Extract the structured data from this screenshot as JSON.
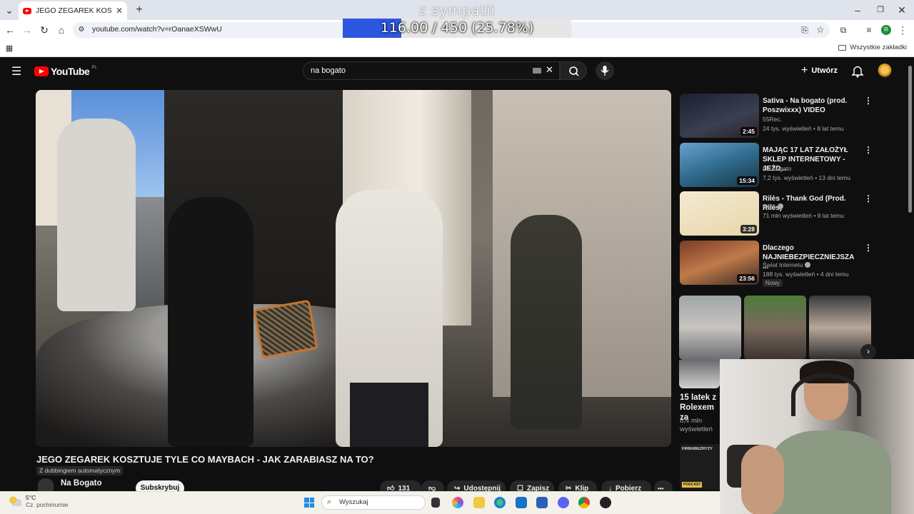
{
  "browser": {
    "tab_title": "JEGO ZEGAREK KOSZTUJE TYLE",
    "new_tab": "+",
    "url": "youtube.com/watch?v=rOanaeXSWwU",
    "bookmarks_all": "Wszystkie zakładki",
    "profile_initial": "R"
  },
  "overlay": {
    "title": "z sympatii",
    "progress_text": "116.00 / 450 (25.78%)",
    "progress_fraction": 0.2578,
    "fill_color": "#2c55e0"
  },
  "youtube": {
    "logo_text": "YouTube",
    "logo_country": "PL",
    "search_value": "na bogato",
    "create_label": "Utwórz"
  },
  "video": {
    "title": "JEGO ZEGAREK KOSZTUJE TYLE CO MAYBACH - JAK ZARABIASZ NA TO?",
    "dub_badge": "Z dubbingiem automatycznym",
    "channel": "Na Bogato",
    "subscribe": "Subskrybuj",
    "likes": "131",
    "share": "Udostępnij",
    "save": "Zapisz",
    "clip": "Klip",
    "download": "Pobierz",
    "more": "•••"
  },
  "recommendations": [
    {
      "title": "Sativa - Na bogato (prod. Poszwixxx) VIDEO",
      "channel": "55Rec.",
      "meta": "24 tys. wyświetleń • 8 lat temu",
      "duration": "2:45",
      "verified": false,
      "thumb_color": "#2a2f3a"
    },
    {
      "title": "MAJĄC 17 LAT ZAŁOŻYŁ SKLEP INTERNETOWY - JEŻD...",
      "channel": "Na Bogato",
      "meta": "7,2 tys. wyświetleń • 13 dni temu",
      "duration": "15:34",
      "verified": false,
      "thumb_color": "#3b6f99"
    },
    {
      "title": "Rilès - Thank God (Prod. Rilès)",
      "channel": "Rilès",
      "meta": "71 mln wyświetleń • 9 lat temu",
      "duration": "3:28",
      "verified": true,
      "thumb_color": "#efe3c2"
    },
    {
      "title": "Dlaczego NAJNIEBEZPIECZNIEJSZA ...",
      "channel": "Świat Internetu",
      "meta": "188 tys. wyświetleń • 4 dni temu",
      "duration": "23:56",
      "verified": true,
      "thumb_color": "#6a3b2a"
    }
  ],
  "new_badge": "Nowy",
  "shorts": {
    "title": "15 latek z Rolexem za...",
    "title_visible": "15 latek z Rolexem za",
    "views": "8,4 mln wyświetleń",
    "next_label": "›"
  },
  "podcast": {
    "label": "PODCAST",
    "brand": "FIRMABEZRYZY"
  },
  "taskbar": {
    "temp": "5°C",
    "weather": "Cz. pochmurnie",
    "search_placeholder": "Wyszukaj"
  }
}
